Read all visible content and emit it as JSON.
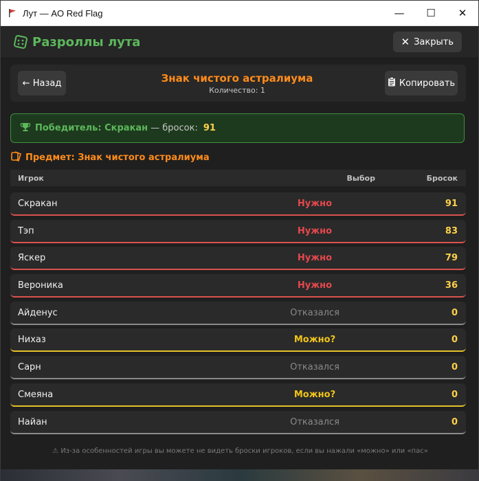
{
  "window": {
    "title": "Лут — AO Red Flag",
    "minimize": "—",
    "maximize": "☐",
    "close": "✕"
  },
  "header": {
    "title": "Разроллы лута",
    "close_label": "Закрыть"
  },
  "item_header": {
    "back_label": "← Назад",
    "item_name": "Знак чистого астралиума",
    "quantity": "Количество: 1",
    "copy_label": "Копировать"
  },
  "winner": {
    "label": "Победитель: Скракан",
    "sep": "— бросок:",
    "roll": "91"
  },
  "item_line": {
    "label": "Предмет: Знак чистого астралиума"
  },
  "table": {
    "headers": {
      "player": "Игрок",
      "choice": "Выбор",
      "roll": "Бросок"
    },
    "rows": [
      {
        "player": "Скракан",
        "choice": "Нужно",
        "roll": "91",
        "type": "need"
      },
      {
        "player": "Тэп",
        "choice": "Нужно",
        "roll": "83",
        "type": "need"
      },
      {
        "player": "Яскер",
        "choice": "Нужно",
        "roll": "79",
        "type": "need"
      },
      {
        "player": "Вероника",
        "choice": "Нужно",
        "roll": "36",
        "type": "need"
      },
      {
        "player": "Айденус",
        "choice": "Отказался",
        "roll": "0",
        "type": "pass"
      },
      {
        "player": "Нихаз",
        "choice": "Можно?",
        "roll": "0",
        "type": "greed"
      },
      {
        "player": "Сарн",
        "choice": "Отказался",
        "roll": "0",
        "type": "pass"
      },
      {
        "player": "Смеяна",
        "choice": "Можно?",
        "roll": "0",
        "type": "greed"
      },
      {
        "player": "Найан",
        "choice": "Отказался",
        "roll": "0",
        "type": "pass"
      }
    ]
  },
  "footer": {
    "note": "Из-за особенностей игры вы можете не видеть броски игроков, если вы нажали «можно» или «пас»"
  },
  "colors": {
    "accent_green": "#5cb85c",
    "accent_orange": "#ff8c1a",
    "need": "#e5484d",
    "greed": "#f0c419",
    "roll": "#ffd24a"
  }
}
